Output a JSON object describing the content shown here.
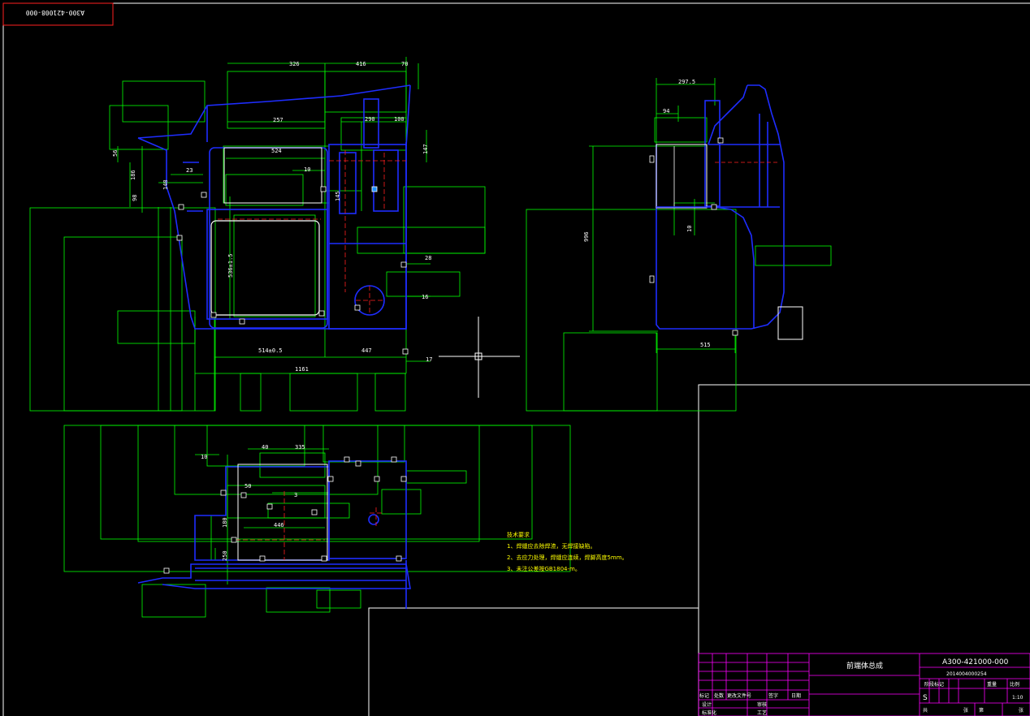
{
  "drawing": {
    "corner_number": "A300-421008-000",
    "colors": {
      "background": "#000000",
      "part_outline": "#1e2dff",
      "part_outline_light": "#6b7bff",
      "dimension_lines": "#00ff00",
      "dimension_text": "#ffffff",
      "centerline": "#ff2020",
      "notes": "#ffff00",
      "title_block_lines": "#ff00ff",
      "frame": "#ffffff",
      "corner_box": "#ff2020"
    }
  },
  "front_view": {
    "dims": {
      "top_326": "326",
      "top_416": "416",
      "top_70": "70",
      "top_257": "257",
      "top_290": "290",
      "top_100": "100",
      "d_56": "56",
      "d_524": "524",
      "d_147": "147",
      "d_186": "186",
      "d_23": "23",
      "d_10a": "10",
      "d_148": "148",
      "d_98": "98",
      "d_145": "145",
      "d_536": "536±1.5",
      "d_28": "28",
      "d_16": "16",
      "bot_514": "514±0.5",
      "bot_447": "447",
      "bot_1161": "1161",
      "bot_17": "17"
    }
  },
  "side_view": {
    "dims": {
      "top_2975": "297.5",
      "d_94": "94",
      "d_996": "996",
      "d_10": "10",
      "bot_515": "515"
    }
  },
  "top_view": {
    "dims": {
      "d_40": "40",
      "d_335": "335",
      "d_10": "10",
      "d_50": "50",
      "d_3": "3",
      "d_446": "446",
      "d_180": "180",
      "d_250": "250"
    }
  },
  "tech_notes": {
    "title": "技术要求",
    "items": [
      "1、焊缝应去除焊渣，无焊接缺陷。",
      "2、去应力处理，焊缝应连续，焊脚高度5mm。",
      "3、未注公差按GB1804-m。"
    ]
  },
  "title_block": {
    "name": "前端体总成",
    "number": "A300-421000-000",
    "sub_number": "2014004000254",
    "scale": "1:10",
    "grade": "S",
    "head_labels": [
      "标记",
      "处数",
      "更改文件号",
      "签字",
      "日期"
    ],
    "row_labels": [
      "设计",
      "标准化",
      "审核",
      "工艺",
      "批准"
    ],
    "right_labels": [
      "阶段标记",
      "重量",
      "比例"
    ],
    "bottom_labels": [
      "共",
      "张",
      "第",
      "张"
    ]
  }
}
